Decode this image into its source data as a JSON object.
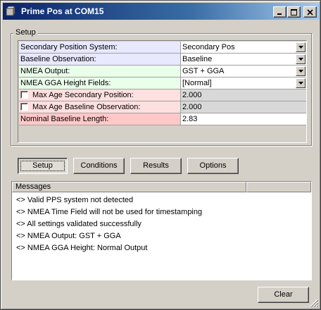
{
  "window": {
    "title": "Prime Pos at COM15",
    "icons": {
      "app": "instrument-icon",
      "minimize": "minimize-icon",
      "maximize": "maximize-icon",
      "close": "close-icon"
    }
  },
  "setup_group": {
    "label": "Setup",
    "rows": [
      {
        "label": "Secondary Position System:",
        "value": "Secondary Pos",
        "control": "dropdown"
      },
      {
        "label": "Baseline Observation:",
        "value": "Baseline",
        "control": "dropdown"
      },
      {
        "label": "NMEA Output:",
        "value": "GST + GGA",
        "control": "dropdown"
      },
      {
        "label": "NMEA GGA Height Fields:",
        "value": "[Normal]",
        "control": "dropdown"
      },
      {
        "label": "Max Age Secondary Position:",
        "value": "2.000",
        "control": "checkbox-readonly",
        "checked": false
      },
      {
        "label": "Max Age Baseline Observation:",
        "value": "2.000",
        "control": "checkbox-readonly",
        "checked": false
      },
      {
        "label": "Nominal Baseline Length:",
        "value": "2.83",
        "control": "text"
      }
    ],
    "colors": {
      "blue": "#e8e8ff",
      "green": "#eaffea",
      "pink": "#ffe0e0",
      "pink_strong": "#ffc8c8"
    }
  },
  "tabs": [
    {
      "label": "Setup",
      "active": true
    },
    {
      "label": "Conditions",
      "active": false
    },
    {
      "label": "Results",
      "active": false
    },
    {
      "label": "Options",
      "active": false
    }
  ],
  "messages": {
    "header": "Messages",
    "items": [
      "<> Valid PPS system not detected",
      "<> NMEA Time Field will not be used for timestamping",
      "<> All settings validated successfully",
      "<> NMEA Output: GST + GGA",
      "<> NMEA GGA Height: Normal Output"
    ]
  },
  "footer": {
    "clear_label": "Clear"
  }
}
